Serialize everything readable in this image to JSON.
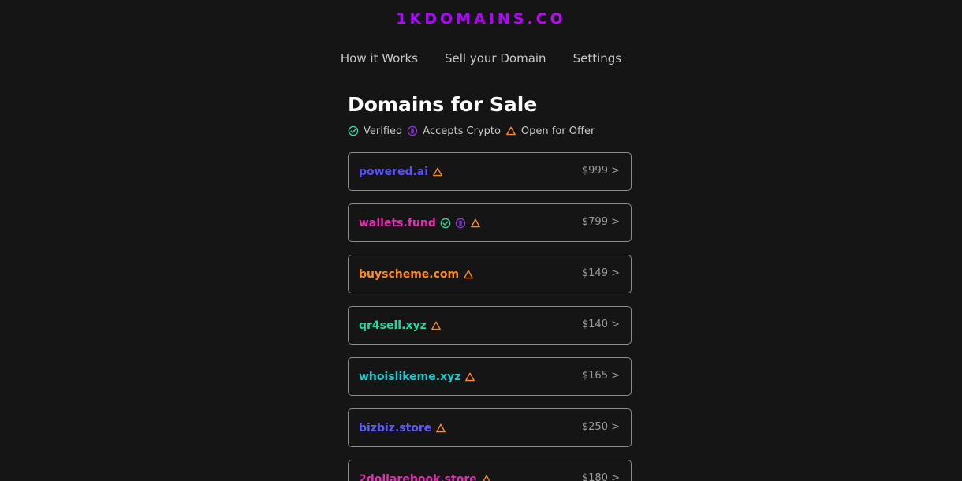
{
  "brand": {
    "name": "1KDOMAINS.CO"
  },
  "nav": {
    "items": [
      {
        "label": "How it Works"
      },
      {
        "label": "Sell your Domain"
      },
      {
        "label": "Settings"
      }
    ]
  },
  "main": {
    "title": "Domains for Sale",
    "legend": {
      "verified": "Verified",
      "crypto": "Accepts Crypto",
      "offer": "Open for Offer"
    }
  },
  "domains": [
    {
      "name": "powered.ai",
      "price": "$999 >",
      "color": "#5b50ff",
      "badges": [
        "offer"
      ]
    },
    {
      "name": "wallets.fund",
      "price": "$799 >",
      "color": "#e52cb2",
      "badges": [
        "verified",
        "crypto",
        "offer"
      ]
    },
    {
      "name": "buyscheme.com",
      "price": "$149 >",
      "color": "#ff8c16",
      "badges": [
        "offer"
      ]
    },
    {
      "name": "qr4sell.xyz",
      "price": "$140 >",
      "color": "#20d99e",
      "badges": [
        "offer"
      ]
    },
    {
      "name": "whoislikeme.xyz",
      "price": "$165 >",
      "color": "#22c8cc",
      "badges": [
        "offer"
      ]
    },
    {
      "name": "bizbiz.store",
      "price": "$250 >",
      "color": "#6158ff",
      "badges": [
        "offer"
      ]
    },
    {
      "name": "2dollarebook.store",
      "price": "$180 >",
      "color": "#e52cb2",
      "badges": [
        "offer"
      ]
    }
  ],
  "icons": {
    "verified": {
      "name": "check-circle-icon",
      "color": "#34d399"
    },
    "crypto": {
      "name": "crypto-coin-icon",
      "color": "#8b3bd1"
    },
    "offer": {
      "name": "warning-triangle-icon",
      "color": "#ff8a1f"
    }
  }
}
